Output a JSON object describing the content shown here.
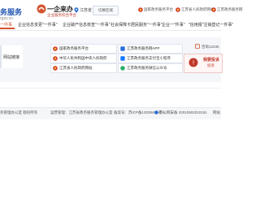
{
  "header": {
    "brand_left": "务服务",
    "brand_left_sub": "rgov.cn",
    "logo_title": "一企来办",
    "logo_sub": "企业服务综合平台",
    "location": "江苏省",
    "switch_label": "切换区域",
    "links": [
      {
        "label": "国家政务服务平台",
        "icon": "national-emblem-icon"
      },
      {
        "label": "江苏省人民政府网站",
        "icon": "emblem-icon"
      },
      {
        "label": "江苏政务服务网",
        "icon": "emblem-icon"
      }
    ]
  },
  "nav": {
    "items": [
      {
        "label": "一件事"
      },
      {
        "label": "企业信息变更\"一件事\""
      },
      {
        "label": "企业破产信息核查\"一件事\""
      },
      {
        "label": "社会保障卡居民服务\"一件事\""
      },
      {
        "label": "企业一\"件事\""
      },
      {
        "label": "\"信用报\"注销登记一件事\""
      }
    ],
    "active_index": 0
  },
  "section1": {
    "side_tab": "网站链接",
    "cards": [
      {
        "label": "国家政务服务平台",
        "icon": "national-emblem-icon"
      },
      {
        "label": "江苏政务服务网APP",
        "icon": "app-icon"
      },
      {
        "label": "中华人民共和国中央人民政府",
        "icon": "national-emblem-icon"
      },
      {
        "label": "江苏政务服务支付宝小程序",
        "icon": "alipay-icon"
      },
      {
        "label": "江苏省人民政府网站",
        "icon": "emblem-icon"
      },
      {
        "label": "江苏政务服务微信公众号",
        "icon": "wechat-icon"
      }
    ],
    "hotline": "咨询12345",
    "complaint_title": "我要投诉",
    "complaint_sub": "投诉"
  },
  "footer": {
    "items": [
      "务管理办公室 版权所有",
      "运营管理：江苏省政务服务管理办公室",
      "备案号：苏ICP备13039461号-1",
      "苏公网安备 32010502010151",
      "网站"
    ]
  },
  "colors": {
    "accent": "#d4542f",
    "brand_blue": "#2255b0",
    "complaint_red": "#c0392b"
  }
}
